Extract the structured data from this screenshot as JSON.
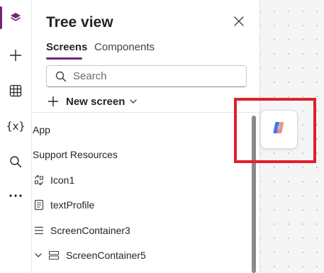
{
  "rail": {
    "items": [
      {
        "name": "tree-view-icon",
        "active": true
      },
      {
        "name": "insert-icon"
      },
      {
        "name": "data-icon"
      },
      {
        "name": "variables-icon",
        "text": "{x}"
      },
      {
        "name": "search-icon"
      },
      {
        "name": "more-icon",
        "text": "···"
      }
    ],
    "accent": "#742774"
  },
  "panel": {
    "title": "Tree view",
    "tabs": [
      {
        "label": "Screens",
        "selected": true
      },
      {
        "label": "Components",
        "selected": false
      }
    ],
    "search": {
      "placeholder": "Search"
    },
    "new_screen": {
      "label": "New screen"
    },
    "tree": [
      {
        "label": "App",
        "icon": "none"
      },
      {
        "label": "Support Resources",
        "icon": "none"
      },
      {
        "label": "Icon1",
        "icon": "icon-control-icon"
      },
      {
        "label": "textProfile",
        "icon": "text-label-icon"
      },
      {
        "label": "ScreenContainer3",
        "icon": "container-icon"
      },
      {
        "label": "ScreenContainer5",
        "icon": "container-icon",
        "expanded": true
      }
    ]
  },
  "canvas": {
    "copilot": {
      "icon": "copilot-icon"
    },
    "highlight_color": "#e0202a"
  }
}
